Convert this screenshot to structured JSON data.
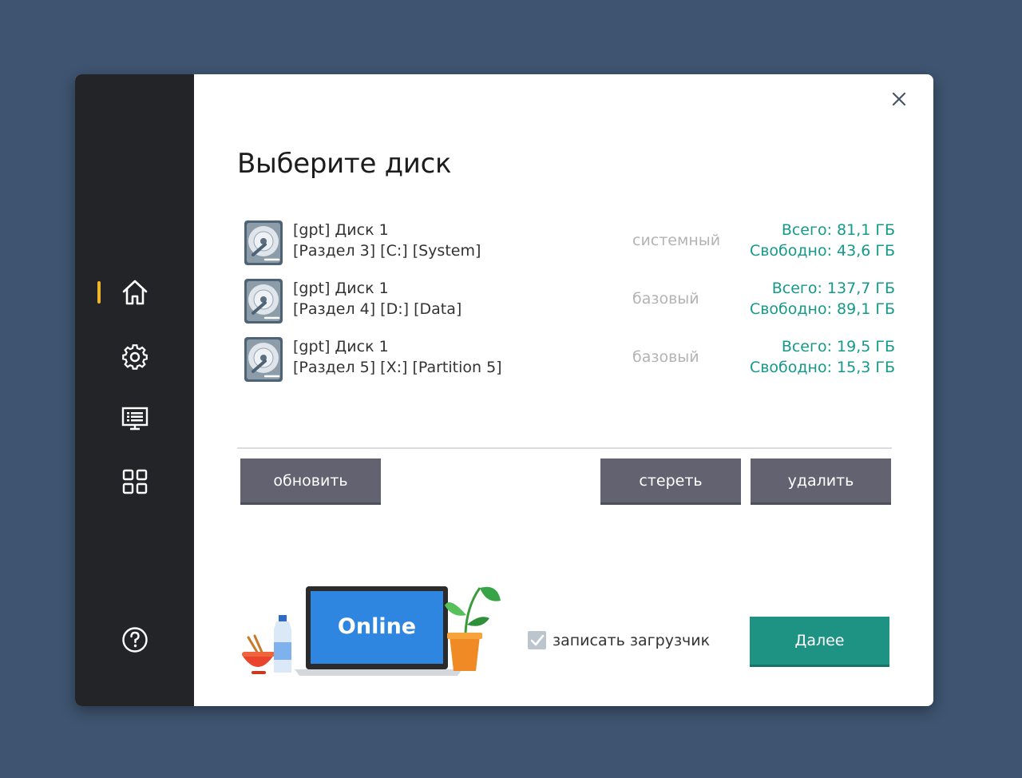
{
  "window": {
    "title": "Выберите диск",
    "close_icon": "close-icon"
  },
  "sidebar": {
    "active_accent": "#f0b429",
    "items": [
      {
        "icon": "home-icon",
        "active": true
      },
      {
        "icon": "gear-icon",
        "active": false
      },
      {
        "icon": "monitor-list-icon",
        "active": false
      },
      {
        "icon": "grid-icon",
        "active": false
      },
      {
        "icon": "help-icon",
        "active": false
      }
    ]
  },
  "disks": [
    {
      "name": "[gpt] Диск 1",
      "partition": "[Раздел 3] [C:] [System]",
      "type": "системный",
      "total": "Всего: 81,1 ГБ",
      "free": "Свободно: 43,6 ГБ"
    },
    {
      "name": "[gpt] Диск 1",
      "partition": "[Раздел 4] [D:] [Data]",
      "type": "базовый",
      "total": "Всего: 137,7 ГБ",
      "free": "Свободно: 89,1 ГБ"
    },
    {
      "name": "[gpt] Диск 1",
      "partition": "[Раздел 5] [X:] [Partition 5]",
      "type": "базовый",
      "total": "Всего: 19,5 ГБ",
      "free": "Свободно: 15,3 ГБ"
    }
  ],
  "buttons": {
    "refresh": "обновить",
    "erase": "стереть",
    "delete": "удалить",
    "next": "Далее"
  },
  "bootloader": {
    "label": "записать загрузчик",
    "checked": true
  },
  "illustration": {
    "screen_text": "Online"
  },
  "colors": {
    "accent_teal": "#1e9383",
    "size_text": "#15998a",
    "button_gray": "#626270",
    "sidebar_bg": "#232427"
  }
}
